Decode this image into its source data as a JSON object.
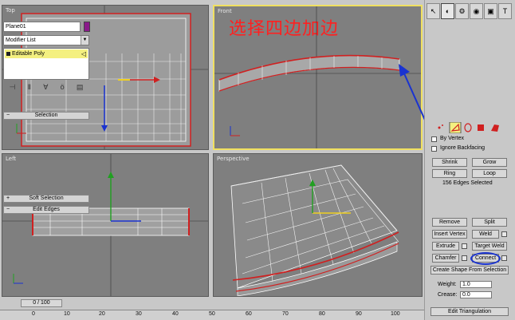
{
  "viewports": {
    "top": {
      "label": "Top"
    },
    "front": {
      "label": "Front"
    },
    "left": {
      "label": "Left"
    },
    "perspective": {
      "label": "Perspective"
    }
  },
  "annotation": {
    "text": "选择四边加边",
    "color": "#ff2020"
  },
  "panel": {
    "tabs": [
      {
        "icon": "create-arrow-icon",
        "glyph": "↖"
      },
      {
        "icon": "modify-icon",
        "glyph": "◐"
      },
      {
        "icon": "hierarchy-icon",
        "glyph": "⚙"
      },
      {
        "icon": "motion-icon",
        "glyph": "◉"
      },
      {
        "icon": "display-icon",
        "glyph": "▣"
      },
      {
        "icon": "utilities-hammer-icon",
        "glyph": "T"
      }
    ],
    "object_name": "Plane01",
    "object_color": "#8a1a8a",
    "modifier_list": "Modifier List",
    "stack_item": "Editable Poly",
    "selection": {
      "title": "Selection",
      "by_vertex": "By Vertex",
      "ignore_backfacing": "Ignore Backfacing",
      "shrink": "Shrink",
      "grow": "Grow",
      "ring": "Ring",
      "loop": "Loop",
      "status": "156 Edges Selected"
    },
    "soft_selection": {
      "title": "Soft Selection"
    },
    "edit_edges": {
      "title": "Edit Edges",
      "remove": "Remove",
      "split": "Split",
      "insert_vertex": "Insert Vertex",
      "weld": "Weld",
      "extrude": "Extrude",
      "target_weld": "Target Weld",
      "chamfer": "Chamfer",
      "connect": "Connect",
      "create_shape": "Create Shape From Selection",
      "weight_label": "Weight:",
      "weight_value": "1.0",
      "crease_label": "Crease:",
      "crease_value": "0.0",
      "edit_triangulation": "Edit Triangulation"
    }
  },
  "timeline": {
    "slider": "0 / 100",
    "ticks": [
      "0",
      "10",
      "20",
      "30",
      "40",
      "50",
      "60",
      "70",
      "80",
      "90",
      "100"
    ]
  },
  "colors": {
    "accent_arrow": "#1a33d0",
    "active_viewport": "#f0e060",
    "selected_edges": "#cc2020"
  }
}
